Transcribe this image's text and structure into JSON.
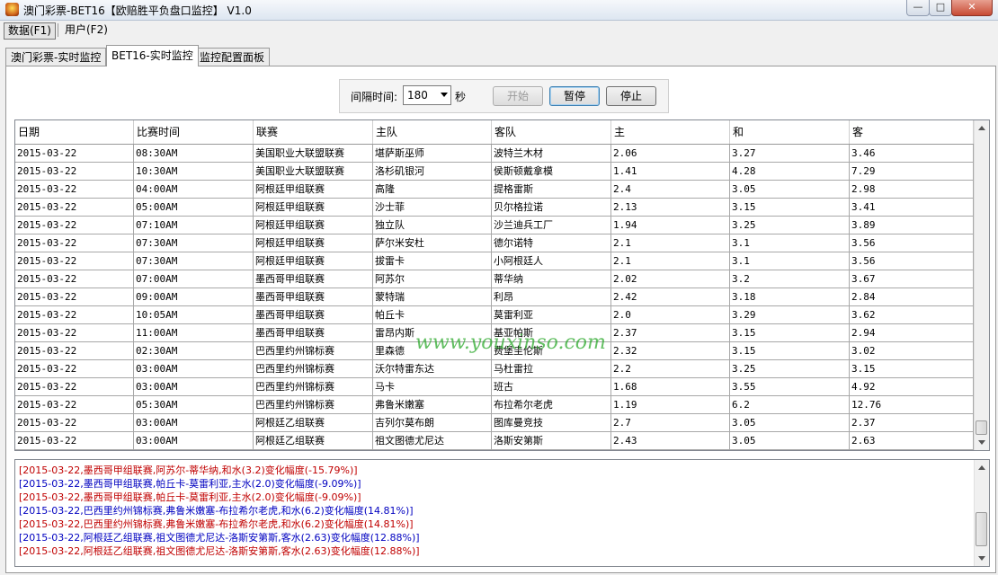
{
  "window": {
    "title": "澳门彩票-BET16【欧赔胜平负盘口监控】 V1.0",
    "min_label": "—",
    "max_label": "□",
    "close_label": "✕"
  },
  "menu": {
    "data": "数据(F1)",
    "user": "用户(F2)"
  },
  "tabs": [
    {
      "label": "澳门彩票-实时监控"
    },
    {
      "label": "BET16-实时监控"
    },
    {
      "label": "监控配置面板"
    }
  ],
  "controls": {
    "interval_label": "间隔时间:",
    "interval_value": "180",
    "seconds_label": "秒",
    "start": "开始",
    "pause": "暂停",
    "stop": "停止"
  },
  "table": {
    "columns": [
      "日期",
      "比赛时间",
      "联赛",
      "主队",
      "客队",
      "主",
      "和",
      "客"
    ],
    "rows": [
      [
        "2015-03-22",
        "08:30AM",
        "美国职业大联盟联赛",
        "堪萨斯巫师",
        "波特兰木材",
        "2.06",
        "3.27",
        "3.46"
      ],
      [
        "2015-03-22",
        "10:30AM",
        "美国职业大联盟联赛",
        "洛杉矶银河",
        "侯斯顿戴拿模",
        "1.41",
        "4.28",
        "7.29"
      ],
      [
        "2015-03-22",
        "04:00AM",
        "阿根廷甲组联赛",
        "高隆",
        "提格雷斯",
        "2.4",
        "3.05",
        "2.98"
      ],
      [
        "2015-03-22",
        "05:00AM",
        "阿根廷甲组联赛",
        "沙士菲",
        "贝尔格拉诺",
        "2.13",
        "3.15",
        "3.41"
      ],
      [
        "2015-03-22",
        "07:10AM",
        "阿根廷甲组联赛",
        "独立队",
        "沙兰迪兵工厂",
        "1.94",
        "3.25",
        "3.89"
      ],
      [
        "2015-03-22",
        "07:30AM",
        "阿根廷甲组联赛",
        "萨尔米安杜",
        "德尔诺特",
        "2.1",
        "3.1",
        "3.56"
      ],
      [
        "2015-03-22",
        "07:30AM",
        "阿根廷甲组联赛",
        "拔雷卡",
        "小阿根廷人",
        "2.1",
        "3.1",
        "3.56"
      ],
      [
        "2015-03-22",
        "07:00AM",
        "墨西哥甲组联赛",
        "阿苏尔",
        "蒂华纳",
        "2.02",
        "3.2",
        "3.67"
      ],
      [
        "2015-03-22",
        "09:00AM",
        "墨西哥甲组联赛",
        "蒙特瑞",
        "利昂",
        "2.42",
        "3.18",
        "2.84"
      ],
      [
        "2015-03-22",
        "10:05AM",
        "墨西哥甲组联赛",
        "帕丘卡",
        "莫雷利亚",
        "2.0",
        "3.29",
        "3.62"
      ],
      [
        "2015-03-22",
        "11:00AM",
        "墨西哥甲组联赛",
        "雷昂内斯",
        "基亚帕斯",
        "2.37",
        "3.15",
        "2.94"
      ],
      [
        "2015-03-22",
        "02:30AM",
        "巴西里约州锦标赛",
        "里森德",
        "费堡圭伦斯",
        "2.32",
        "3.15",
        "3.02"
      ],
      [
        "2015-03-22",
        "03:00AM",
        "巴西里约州锦标赛",
        "沃尔特雷东达",
        "马杜雷拉",
        "2.2",
        "3.25",
        "3.15"
      ],
      [
        "2015-03-22",
        "03:00AM",
        "巴西里约州锦标赛",
        "马卡",
        "班古",
        "1.68",
        "3.55",
        "4.92"
      ],
      [
        "2015-03-22",
        "05:30AM",
        "巴西里约州锦标赛",
        "弗鲁米嫩塞",
        "布拉希尔老虎",
        "1.19",
        "6.2",
        "12.76"
      ],
      [
        "2015-03-22",
        "03:00AM",
        "阿根廷乙组联赛",
        "吉列尔莫布朗",
        "图库曼竞技",
        "2.7",
        "3.05",
        "2.37"
      ],
      [
        "2015-03-22",
        "03:00AM",
        "阿根廷乙组联赛",
        "祖文图德尤尼达",
        "洛斯安第斯",
        "2.43",
        "3.05",
        "2.63"
      ]
    ]
  },
  "watermark": "www.youxinso.com",
  "log": [
    {
      "text": "[2015-03-22,墨西哥甲组联赛,阿苏尔-蒂华纳,和水(3.2)变化幅度(-15.79%)]",
      "color": "red"
    },
    {
      "text": "[2015-03-22,墨西哥甲组联赛,帕丘卡-莫雷利亚,主水(2.0)变化幅度(-9.09%)]",
      "color": "blue"
    },
    {
      "text": "[2015-03-22,墨西哥甲组联赛,帕丘卡-莫雷利亚,主水(2.0)变化幅度(-9.09%)]",
      "color": "red"
    },
    {
      "text": "[2015-03-22,巴西里约州锦标赛,弗鲁米嫩塞-布拉希尔老虎,和水(6.2)变化幅度(14.81%)]",
      "color": "blue"
    },
    {
      "text": "[2015-03-22,巴西里约州锦标赛,弗鲁米嫩塞-布拉希尔老虎,和水(6.2)变化幅度(14.81%)]",
      "color": "red"
    },
    {
      "text": "[2015-03-22,阿根廷乙组联赛,祖文图德尤尼达-洛斯安第斯,客水(2.63)变化幅度(12.88%)]",
      "color": "blue"
    },
    {
      "text": "[2015-03-22,阿根廷乙组联赛,祖文图德尤尼达-洛斯安第斯,客水(2.63)变化幅度(12.88%)]",
      "color": "red"
    }
  ]
}
